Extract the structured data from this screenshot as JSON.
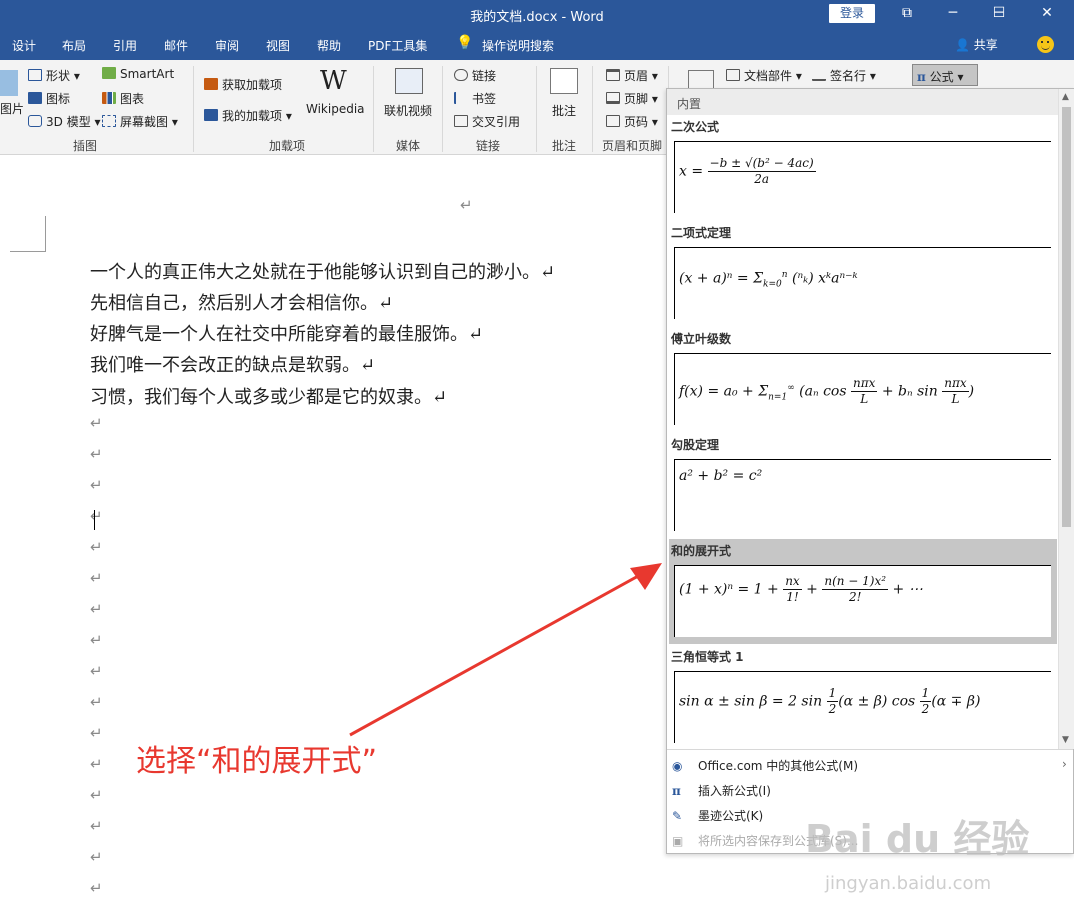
{
  "window": {
    "title": "我的文档.docx - Word",
    "login": "登录",
    "controls": [
      "⧉",
      "─",
      "☐",
      "✕"
    ]
  },
  "menubar": [
    "设计",
    "布局",
    "引用",
    "邮件",
    "审阅",
    "视图",
    "帮助",
    "PDF工具集",
    "操作说明搜索"
  ],
  "share": "共享",
  "ribbon": {
    "illustrations": {
      "shapes": "形状",
      "icons": "图标",
      "model3d": "3D 模型",
      "smartart": "SmartArt",
      "chart": "图表",
      "screenshot": "屏幕截图",
      "pictures_fragment": "图片",
      "group": "插图"
    },
    "addins": {
      "get": "获取加载项",
      "mine": "我的加载项",
      "wikipedia": "Wikipedia",
      "group": "加载项"
    },
    "media": {
      "video": "联机视频",
      "group": "媒体"
    },
    "links": {
      "link": "链接",
      "bookmark": "书签",
      "crossref": "交叉引用",
      "group": "链接"
    },
    "comments": {
      "comment": "批注",
      "group": "批注"
    },
    "headerfooter": {
      "header": "页眉",
      "footer": "页脚",
      "pagenum": "页码",
      "group": "页眉和页脚"
    },
    "text": {
      "docparts": "文档部件",
      "signature": "签名行"
    },
    "equation": "公式"
  },
  "document": {
    "lines": [
      "一个人的真正伟大之处就在于他能够认识到自己的渺小。↵",
      "先相信自己，然后别人才会相信你。↵",
      "好脾气是一个人在社交中所能穿着的最佳服饰。↵",
      "我们唯一不会改正的缺点是软弱。↵",
      "习惯，我们每个人或多或少都是它的奴隶。↵"
    ],
    "paragraph_mark": "↵"
  },
  "equation_panel": {
    "header": "内置",
    "items": [
      {
        "name": "二次公式"
      },
      {
        "name": "二项式定理"
      },
      {
        "name": "傅立叶级数"
      },
      {
        "name": "勾股定理"
      },
      {
        "name": "和的展开式",
        "selected": true
      },
      {
        "name": "三角恒等式 1"
      }
    ],
    "options": [
      "Office.com 中的其他公式(M)",
      "插入新公式(I)",
      "墨迹公式(K)",
      "将所选内容保存到公式库(S)..."
    ]
  },
  "annotation": "选择“和的展开式”",
  "watermark": {
    "main": "Bai du 经验",
    "sub": "jingyan.baidu.com"
  },
  "colors": {
    "accent": "#2b579a",
    "annotation": "#e8382f"
  }
}
